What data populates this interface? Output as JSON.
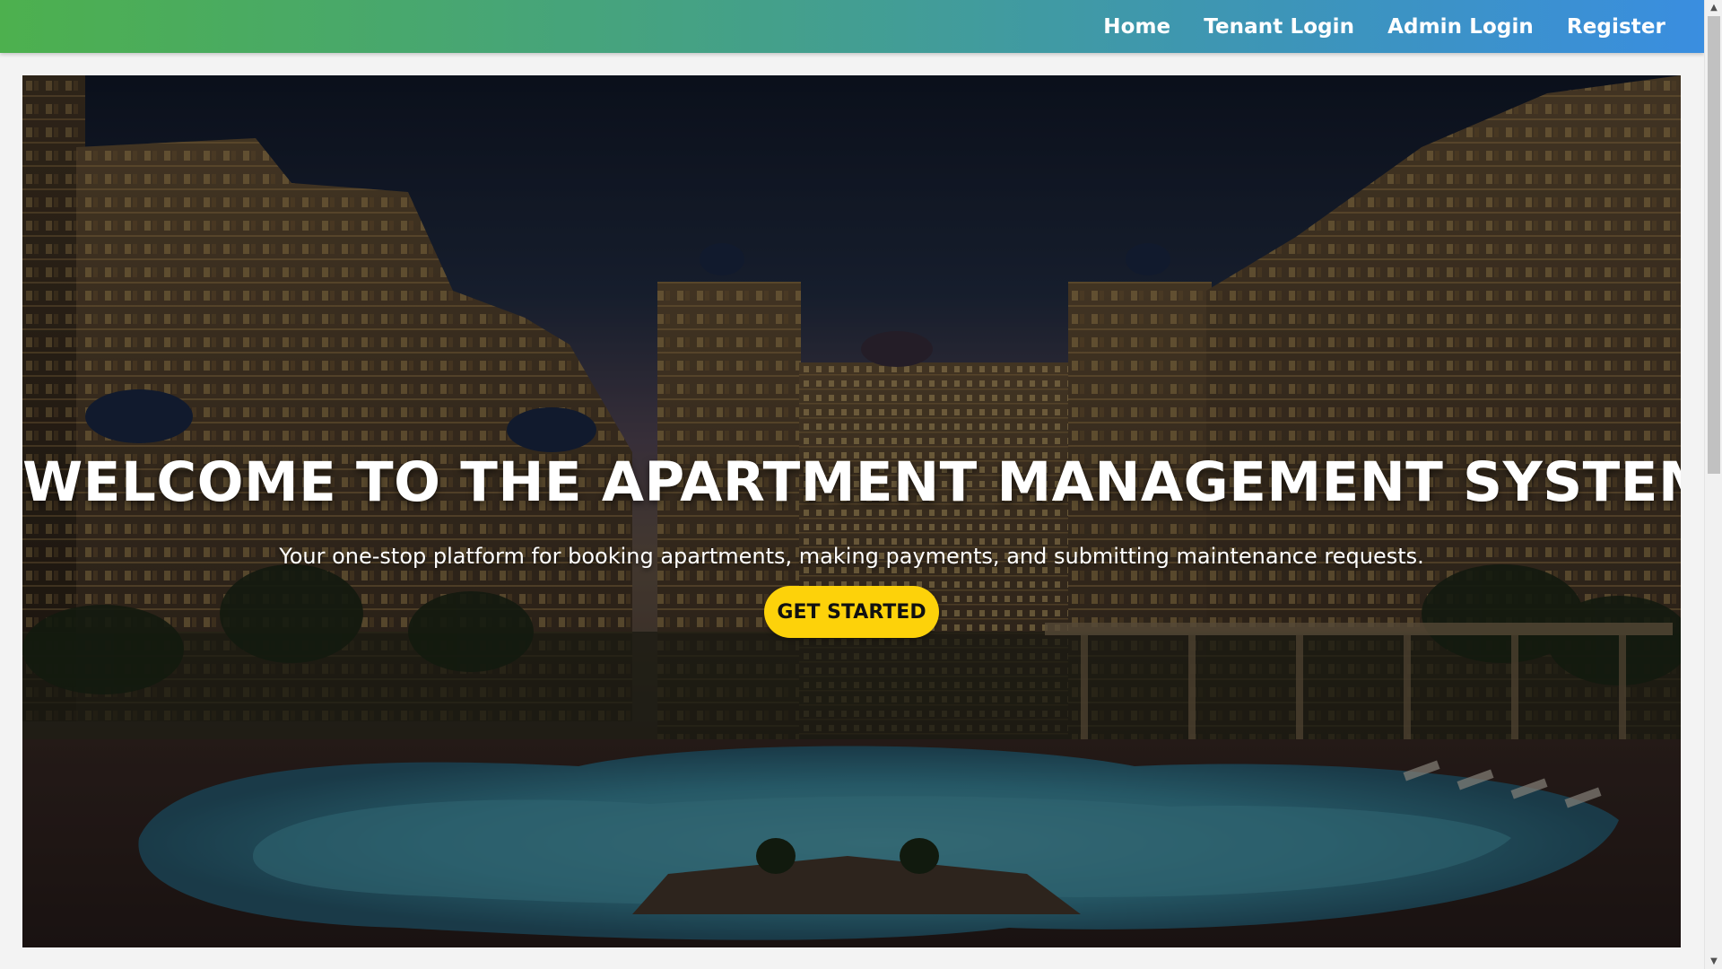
{
  "nav": {
    "items": [
      {
        "label": "Home"
      },
      {
        "label": "Tenant Login"
      },
      {
        "label": "Admin Login"
      },
      {
        "label": "Register"
      }
    ]
  },
  "hero": {
    "title": "WELCOME TO THE APARTMENT MANAGEMENT SYSTEM",
    "subtitle": "Your one-stop platform for booking apartments, making payments, and submitting maintenance requests.",
    "cta_label": "GET STARTED",
    "background_image": "night-view-of-apartment-complex-with-pool"
  },
  "scrollbar": {
    "up_icon": "scroll-up-arrow-icon",
    "down_icon": "scroll-down-arrow-icon"
  },
  "colors": {
    "nav_gradient_start": "#4db04e",
    "nav_gradient_end": "#3a8ee0",
    "cta_background": "#fdd20a",
    "page_background": "#f3f3f3"
  }
}
